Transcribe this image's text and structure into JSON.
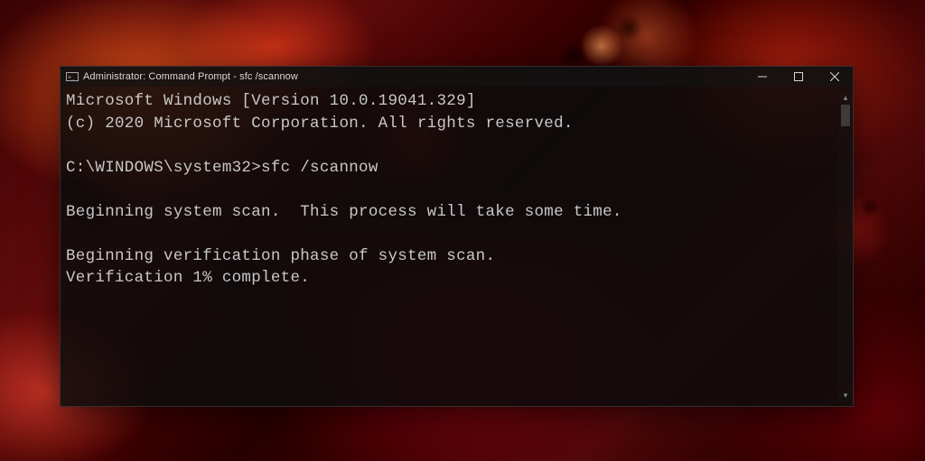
{
  "window": {
    "title": "Administrator: Command Prompt - sfc  /scannow"
  },
  "terminal": {
    "lines": [
      "Microsoft Windows [Version 10.0.19041.329]",
      "(c) 2020 Microsoft Corporation. All rights reserved.",
      "",
      "C:\\WINDOWS\\system32>sfc /scannow",
      "",
      "Beginning system scan.  This process will take some time.",
      "",
      "Beginning verification phase of system scan.",
      "Verification 1% complete."
    ]
  }
}
